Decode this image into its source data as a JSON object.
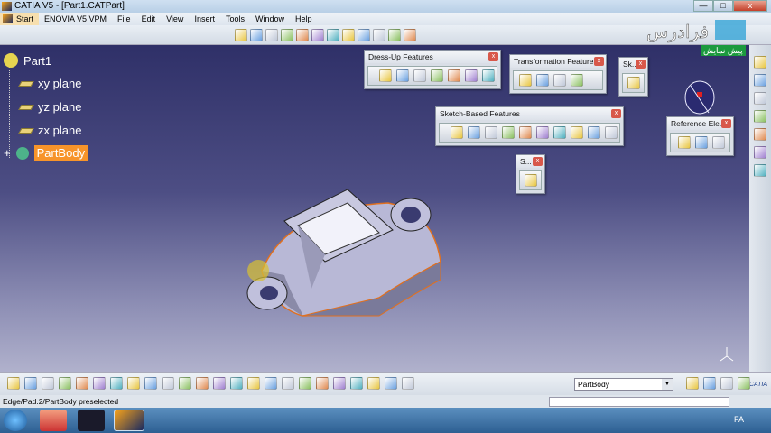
{
  "window": {
    "title": "CATIA V5 - [Part1.CATPart]",
    "min": "—",
    "max": "□",
    "close": "x"
  },
  "menu": [
    "Start",
    "ENOVIA V5 VPM",
    "File",
    "Edit",
    "View",
    "Insert",
    "Tools",
    "Window",
    "Help"
  ],
  "watermark": {
    "brand": "فرادرس",
    "badge": "پیش نمایش"
  },
  "tree": {
    "root": "Part1",
    "items": [
      "xy plane",
      "yz plane",
      "zx plane"
    ],
    "body": "PartBody"
  },
  "panels": {
    "dressup": {
      "title": "Dress-Up Features",
      "icons": [
        "fillet-icon",
        "chamfer-icon",
        "draft-icon",
        "shell-icon",
        "thickness-icon",
        "thread-icon",
        "remove-face-icon"
      ]
    },
    "transform": {
      "title": "Transformation Features",
      "icons": [
        "translation-icon",
        "mirror-icon",
        "rect-pattern-icon",
        "scaling-icon"
      ]
    },
    "sketcher": {
      "title": "Sk...",
      "icons": [
        "sketch-icon"
      ]
    },
    "sketchbased": {
      "title": "Sketch-Based Features",
      "icons": [
        "pad-icon",
        "pocket-icon",
        "shaft-icon",
        "groove-icon",
        "hole-icon",
        "rib-icon",
        "slot-icon",
        "stiffener-icon",
        "multi-section-solid-icon",
        "removed-multi-section-icon"
      ]
    },
    "surface": {
      "title": "S...",
      "icons": [
        "surface-based-icon"
      ]
    },
    "reference": {
      "title": "Reference Ele...",
      "icons": [
        "point-icon",
        "line-icon",
        "plane-icon"
      ]
    }
  },
  "top_toolbar": [
    "fly-mode-icon",
    "fit-all-icon",
    "pan-icon",
    "rotate-icon",
    "zoom-in-icon",
    "zoom-out-icon",
    "normal-view-icon",
    "multi-view-icon",
    "iso-view-icon",
    "shading-icon",
    "hide-show-icon",
    "swap-space-icon"
  ],
  "right_toolbar": [
    "settings-icon",
    "select-icon",
    "sketch-analysis-icon",
    "constraint-icon",
    "measure-icon",
    "apply-material-icon",
    "check-icon"
  ],
  "bottom_toolbar": [
    "new-icon",
    "open-icon",
    "save-icon",
    "print-icon",
    "cut-icon",
    "copy-icon",
    "paste-icon",
    "undo-icon",
    "redo-icon",
    "whats-this-icon",
    "formula-icon",
    "comment-icon",
    "table-icon",
    "graph-icon",
    "catalog-icon",
    "knowledge-icon",
    "measure-between-icon",
    "measure-item-icon",
    "mass-icon",
    "photo-icon",
    "update-icon",
    "axis-icon",
    "units-icon",
    "part-body-icon",
    "boolean-icon",
    "insert-body-icon",
    "render-icon",
    "style-icon"
  ],
  "combo": {
    "value": "PartBody"
  },
  "status": {
    "text": "Edge/Pad.2/PartBody preselected"
  },
  "taskbar": {
    "lang": "FA"
  },
  "catia_logo": "CATIA"
}
